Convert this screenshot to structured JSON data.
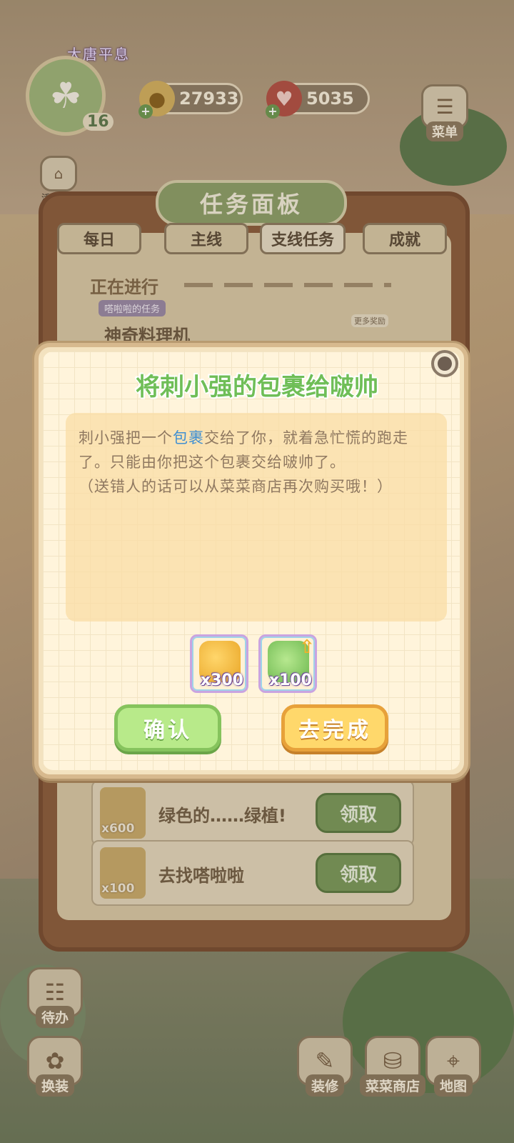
{
  "hud": {
    "player_name": "大唐平息",
    "level": "16",
    "coins": "27933",
    "hearts": "5035",
    "menu_label": "菜单",
    "activity_label": "活动汇总"
  },
  "task_panel": {
    "title": "任务面板",
    "tabs": [
      {
        "label": "每日"
      },
      {
        "label": "主线"
      },
      {
        "label": "支线任务"
      },
      {
        "label": "成就"
      }
    ],
    "section": "正在进行",
    "tag": "嗒啦啦的任务",
    "current_task": "神奇料理机",
    "more_rewards": "更多奖励",
    "rows": [
      {
        "qty": "x600",
        "name": "绿色的……绿植!",
        "claim": "领取"
      },
      {
        "qty": "x100",
        "name": "去找嗒啦啦",
        "claim": "领取"
      }
    ]
  },
  "bottom_bar": {
    "todo": "待办",
    "dress": "换装",
    "decorate": "装修",
    "shop": "菜菜商店",
    "map": "地图"
  },
  "dialog": {
    "title": "将刺小强的包裹给啵帅",
    "desc_part1": "刺小强把一个",
    "desc_highlight": "包裹",
    "desc_part2": "交给了你，就着急忙慌的跑走了。只能由你把这个包裹交给啵帅了。",
    "desc_note": "（送错人的话可以从菜菜商店再次购买哦！）",
    "rewards": [
      {
        "icon": "coin-pile-icon",
        "qty": "x300"
      },
      {
        "icon": "leaf-exp-icon",
        "qty": "x100"
      }
    ],
    "confirm_label": "确认",
    "go_label": "去完成"
  },
  "colors": {
    "title_green": "#6fbe57",
    "highlight_blue": "#3f8fd2",
    "confirm_green": "#b8ea8a",
    "go_yellow": "#ffd86b"
  }
}
